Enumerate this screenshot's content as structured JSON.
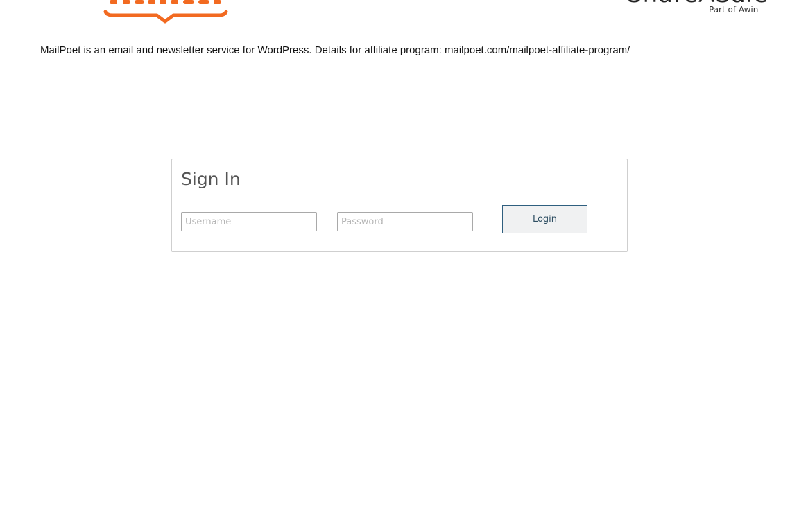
{
  "header": {
    "left_logo": {
      "name": "MailPoet",
      "brand_color": "#f26a21"
    },
    "right_logo": {
      "name": "ShareASale",
      "tagline": "Part of Awin",
      "color": "#222222"
    }
  },
  "description": "MailPoet is an email and newsletter service for WordPress. Details for affiliate program: mailpoet.com/mailpoet-affiliate-program/",
  "signin": {
    "title": "Sign In",
    "username_placeholder": "Username",
    "username_value": "",
    "password_placeholder": "Password",
    "password_value": "",
    "login_label": "Login"
  },
  "colors": {
    "box_border": "#cfcfcf",
    "button_border": "#2f5f7f",
    "button_bg": "#f0f1f2",
    "button_text": "#2f4f63"
  }
}
